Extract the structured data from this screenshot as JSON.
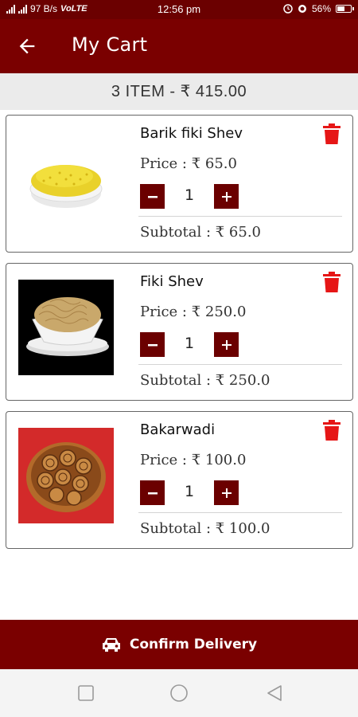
{
  "status_bar": {
    "network_speed": "97 B/s",
    "network_type": "VoLTE",
    "time": "12:56 pm",
    "battery": "56%",
    "battery_level": 0.56
  },
  "app_bar": {
    "title": "My Cart"
  },
  "summary": {
    "text": "3 ITEM - ₹ 415.00"
  },
  "cart": {
    "items": [
      {
        "name": "Barik fiki Shev",
        "price": "Price : ₹ 65.0",
        "quantity": "1",
        "subtotal": "Subtotal : ₹ 65.0"
      },
      {
        "name": "Fiki Shev",
        "price": "Price : ₹ 250.0",
        "quantity": "1",
        "subtotal": "Subtotal : ₹ 250.0"
      },
      {
        "name": "Bakarwadi",
        "price": "Price : ₹ 100.0",
        "quantity": "1",
        "subtotal": "Subtotal : ₹ 100.0"
      }
    ]
  },
  "confirm": {
    "label": "Confirm Delivery"
  },
  "colors": {
    "primary": "#7a0000",
    "primary_dark": "#6b0000",
    "delete": "#e61616"
  },
  "icons": {
    "back": "arrow-back-icon",
    "delete": "trash-icon",
    "minus": "minus-icon",
    "plus": "plus-icon",
    "car": "car-icon",
    "nav_square": "recent-apps-icon",
    "nav_circle": "home-icon",
    "nav_back": "nav-back-icon"
  }
}
